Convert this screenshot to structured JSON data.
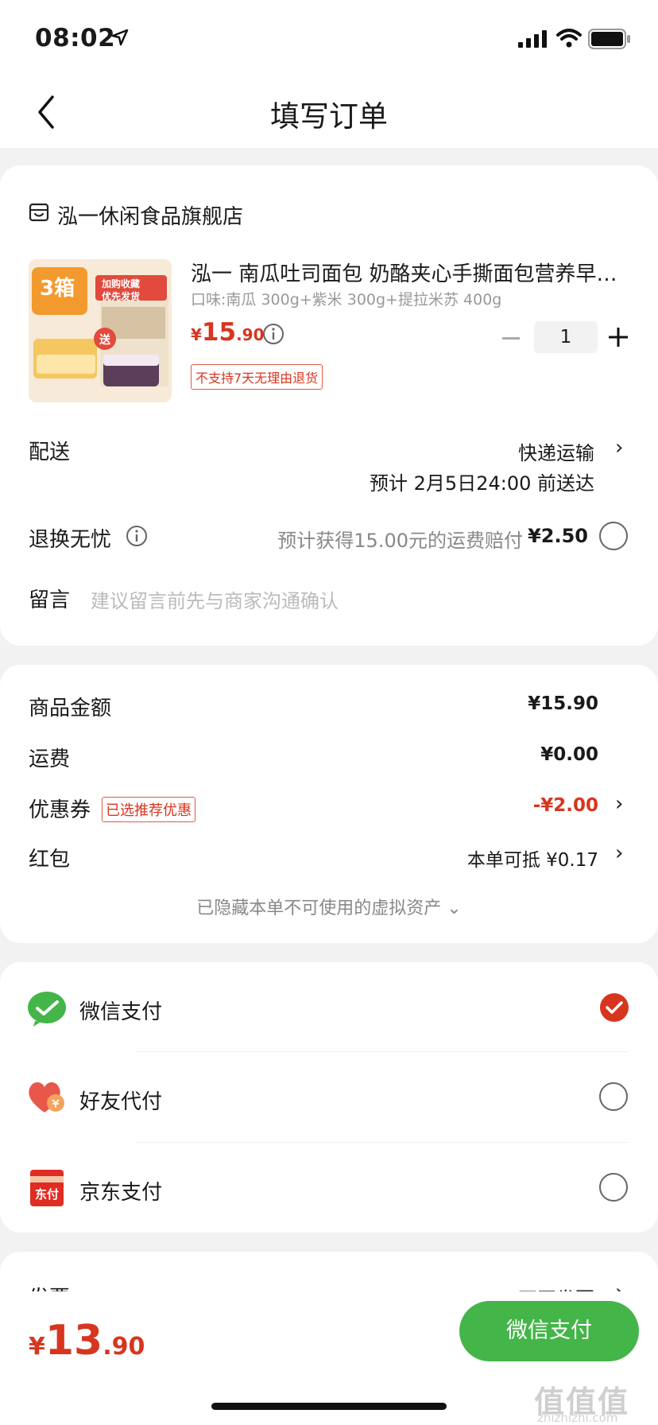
{
  "status_bar": {
    "time": "08:02"
  },
  "nav": {
    "title": "填写订单"
  },
  "store": {
    "name": "泓一休闲食品旗舰店"
  },
  "product": {
    "title": "泓一 南瓜吐司面包 奶酪夹心手撕面包营养早…",
    "spec": "口味:南瓜 300g+紫米 300g+提拉米苏 400g",
    "price_symbol": "¥",
    "price_int": "15",
    "price_dec": ".90",
    "quantity": "1",
    "return_tag": "不支持7天无理由退货",
    "thumb_text": {
      "badge": "3箱",
      "promo_line1": "加购收藏",
      "promo_line2": "优先发货",
      "gift": "送"
    }
  },
  "delivery": {
    "label": "配送",
    "method": "快递运输",
    "eta": "预计 2月5日24:00 前送达"
  },
  "return_insurance": {
    "label": "退换无忧",
    "desc": "预计获得15.00元的运费赔付",
    "price": "¥2.50"
  },
  "message": {
    "label": "留言",
    "placeholder": "建议留言前先与商家沟通确认"
  },
  "summary": {
    "goods_label": "商品金额",
    "goods_value": "¥15.90",
    "shipping_label": "运费",
    "shipping_value": "¥0.00",
    "coupon_label": "优惠券",
    "coupon_tag": "已选推荐优惠",
    "coupon_value": "-¥2.00",
    "redpacket_label": "红包",
    "redpacket_value": "本单可抵 ¥0.17",
    "hidden_assets": "已隐藏本单不可使用的虚拟资产 ⌄"
  },
  "payment_methods": [
    {
      "label": "微信支付",
      "selected": true
    },
    {
      "label": "好友代付",
      "selected": false
    },
    {
      "label": "京东支付",
      "selected": false
    }
  ],
  "jd_icon_text": "东付",
  "partial_row": {
    "left": "发票",
    "right": "不开发票"
  },
  "bottom": {
    "total_symbol": "¥",
    "total_int": "13",
    "total_dec": ".90",
    "pay_button": "微信支付"
  },
  "watermark": {
    "main": "值值值",
    "sub": "zhizhizhi.com"
  },
  "colors": {
    "accent_red": "#d8351f",
    "wechat_green": "#44b549"
  }
}
